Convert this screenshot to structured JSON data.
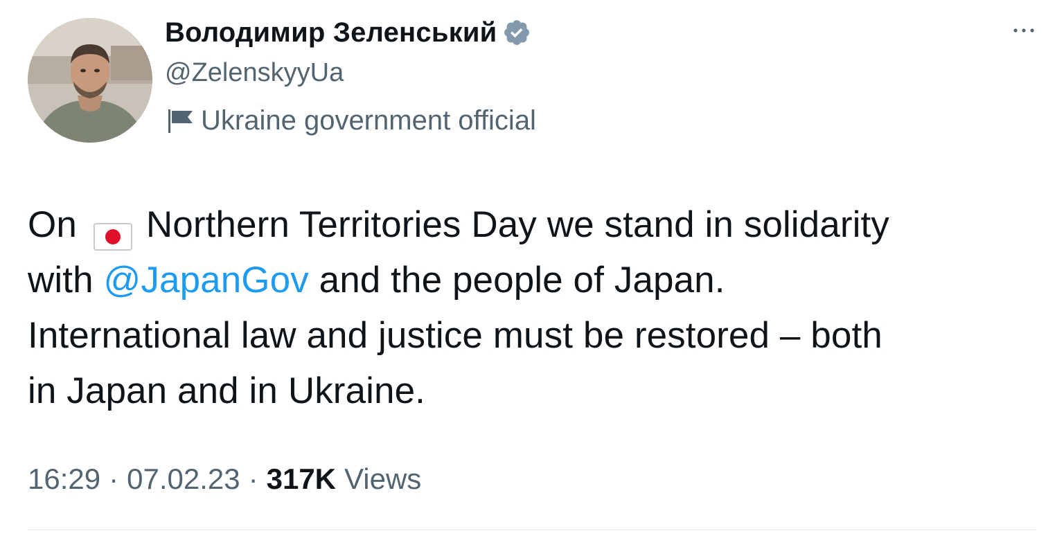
{
  "author": {
    "display_name": "Володимир Зеленський",
    "handle": "@ZelenskyyUa",
    "label": "Ukraine government official",
    "verified": true,
    "verified_color": "#829aab"
  },
  "icons": {
    "verified": "verified-badge-icon",
    "label": "flag-icon",
    "more": "more-options-icon",
    "emoji": "japan-flag-emoji"
  },
  "tweet": {
    "line1_prefix": "On",
    "line1_suffix": "Northern Territories Day we stand in solidarity",
    "line2_prefix": "with",
    "mention": "@JapanGov",
    "line2_suffix": " and the people of Japan.",
    "line3": "International law and justice must be restored – both",
    "line4": "in Japan and in Ukraine."
  },
  "meta": {
    "time": "16:29",
    "separator": "·",
    "date": "07.02.23",
    "views_count": "317K",
    "views_label": "Views"
  },
  "colors": {
    "text": "#0f1419",
    "secondary": "#536471",
    "link": "#1d9bf0"
  }
}
